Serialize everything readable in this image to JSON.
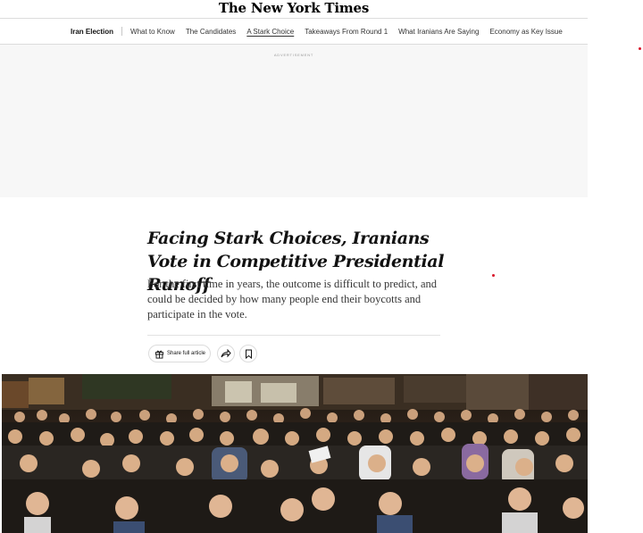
{
  "masthead": {
    "logo_text": "The New York Times"
  },
  "subnav": {
    "section": "Iran Election",
    "links": [
      {
        "label": "What to Know",
        "active": false
      },
      {
        "label": "The Candidates",
        "active": false
      },
      {
        "label": "A Stark Choice",
        "active": true
      },
      {
        "label": "Takeaways From Round 1",
        "active": false
      },
      {
        "label": "What Iranians Are Saying",
        "active": false
      },
      {
        "label": "Economy as Key Issue",
        "active": false
      }
    ]
  },
  "ad": {
    "label": "ADVERTISEMENT"
  },
  "article": {
    "headline": "Facing Stark Choices, Iranians Vote in Competitive Presidential Runoff",
    "summary": "For the first time in years, the outcome is difficult to predict, and could be decided by how many people end their boycotts and participate in the vote."
  },
  "actions": {
    "share_label": "Share full article",
    "share_icon": "gift-icon",
    "forward_icon": "share-arrow-icon",
    "save_icon": "bookmark-icon"
  },
  "colors": {
    "accent_red": "#d8152a",
    "ad_bg": "#f7f7f7"
  }
}
